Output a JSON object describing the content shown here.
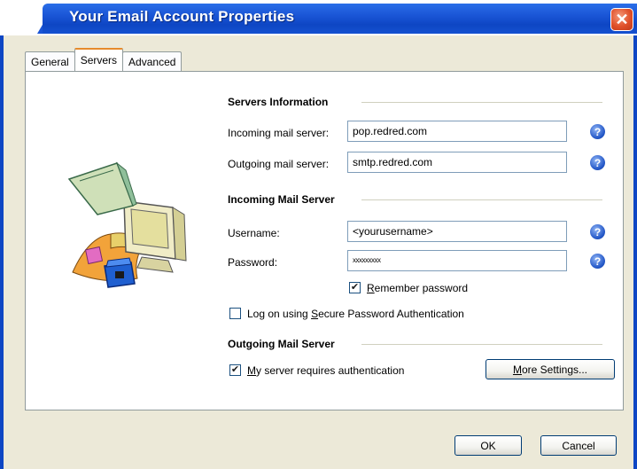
{
  "window": {
    "title": "Your Email Account Properties",
    "close_glyph": "✕"
  },
  "tabs": [
    {
      "label": "General"
    },
    {
      "label": "Servers"
    },
    {
      "label": "Advanced"
    }
  ],
  "servers_info": {
    "title": "Servers Information",
    "incoming_label": "Incoming mail server:",
    "incoming_value": "pop.redred.com",
    "outgoing_label": "Outgoing mail server:",
    "outgoing_value": "smtp.redred.com"
  },
  "incoming_server": {
    "title": "Incoming Mail Server",
    "username_label": "Username:",
    "username_value": "<yourusername>",
    "password_label": "Password:",
    "password_value": "xxxxxxxxx",
    "remember_password": {
      "prefix": "",
      "mnemonic": "R",
      "rest": "emember password",
      "checked": true
    },
    "spa": {
      "prefix": "Log on using ",
      "mnemonic": "S",
      "rest": "ecure Password Authentication",
      "checked": false
    }
  },
  "outgoing_server": {
    "title": "Outgoing Mail Server",
    "requires_auth": {
      "prefix": "",
      "mnemonic": "M",
      "rest": "y server requires authentication",
      "checked": true
    },
    "more_settings": {
      "prefix": "",
      "mnemonic": "M",
      "rest": "ore Settings..."
    }
  },
  "buttons": {
    "ok": "OK",
    "cancel": "Cancel"
  },
  "help_glyph": "?",
  "colors": {
    "titlebar": "#1a55d6",
    "close": "#e0502a",
    "tab_highlight": "#e68b2c"
  }
}
